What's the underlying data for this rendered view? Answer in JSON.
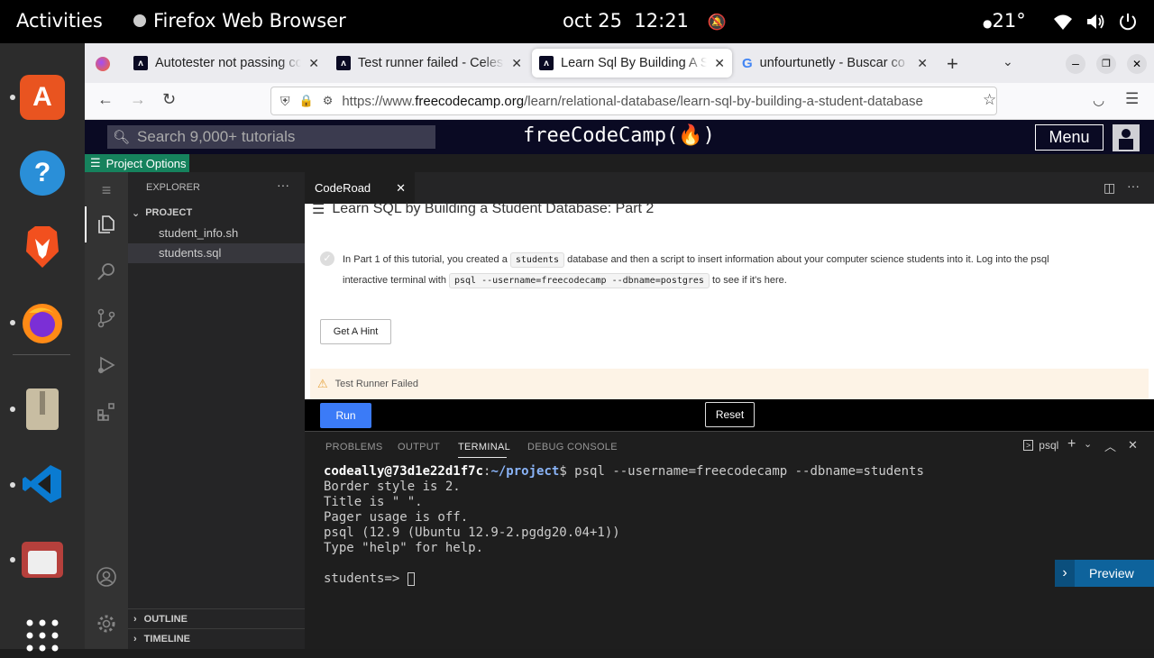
{
  "topbar": {
    "activities": "Activities",
    "app_name": "Firefox Web Browser",
    "date": "oct 25",
    "time": "12:21",
    "temperature": "21°"
  },
  "dock": {
    "apps": [
      "app-center-icon",
      "help-icon",
      "brave-icon",
      "firefox-icon",
      "archive-icon",
      "vscode-icon",
      "files-icon",
      "show-apps-icon"
    ]
  },
  "browser": {
    "tabs": [
      {
        "label": "Autotester not passing co",
        "favicon": "fcc"
      },
      {
        "label": "Test runner failed - Celes",
        "favicon": "fcc"
      },
      {
        "label": "Learn Sql By Building A St",
        "favicon": "fcc",
        "active": true
      },
      {
        "label": "unfourtunetly - Buscar co",
        "favicon": "google"
      }
    ],
    "url_prefix": "https://www.",
    "url_host": "freecodecamp.org",
    "url_path": "/learn/relational-database/learn-sql-by-building-a-student-database"
  },
  "fcc": {
    "search_placeholder": "Search 9,000+ tutorials",
    "logo": "freeCodeCamp(🔥)",
    "menu_label": "Menu"
  },
  "project_options": "Project Options",
  "vscode": {
    "explorer_title": "EXPLORER",
    "project_label": "PROJECT",
    "files": [
      "student_info.sh",
      "students.sql"
    ],
    "outline": "OUTLINE",
    "timeline": "TIMELINE",
    "editor_tab": "CodeRoad"
  },
  "coderoad": {
    "title": "Learn SQL by Building a Student Database: Part 2",
    "step_text_1": "In Part 1 of this tutorial, you created a",
    "code_1": "students",
    "step_text_2": "database and then a script to insert information about your computer science students into it. Log into the psql",
    "step_text_3": "interactive terminal with",
    "code_2": "psql --username=freecodecamp --dbname=postgres",
    "step_text_4": "to see if it's here.",
    "hint_button": "Get A Hint",
    "warning": "Test Runner Failed",
    "run_button": "Run",
    "reset_button": "Reset"
  },
  "panel": {
    "tabs": [
      "PROBLEMS",
      "OUTPUT",
      "TERMINAL",
      "DEBUG CONSOLE"
    ],
    "active_tab": "TERMINAL",
    "terminal_name": "psql",
    "prompt_user": "codeally@73d1e22d1f7c",
    "prompt_path": "~/project",
    "command": "$ psql --username=freecodecamp --dbname=students",
    "output": [
      "Border style is 2.",
      "Title is \" \".",
      "Pager usage is off.",
      "psql (12.9 (Ubuntu 12.9-2.pgdg20.04+1))",
      "Type \"help\" for help."
    ],
    "prompt2": "students=> ",
    "preview_button": "Preview"
  },
  "colors": {
    "fcc_dark": "#0a0a23",
    "vscode_bg": "#1e1e1e",
    "run_blue": "#3b7bf7",
    "preview_blue": "#0e639c",
    "warning_bg": "#fdf3e6"
  }
}
